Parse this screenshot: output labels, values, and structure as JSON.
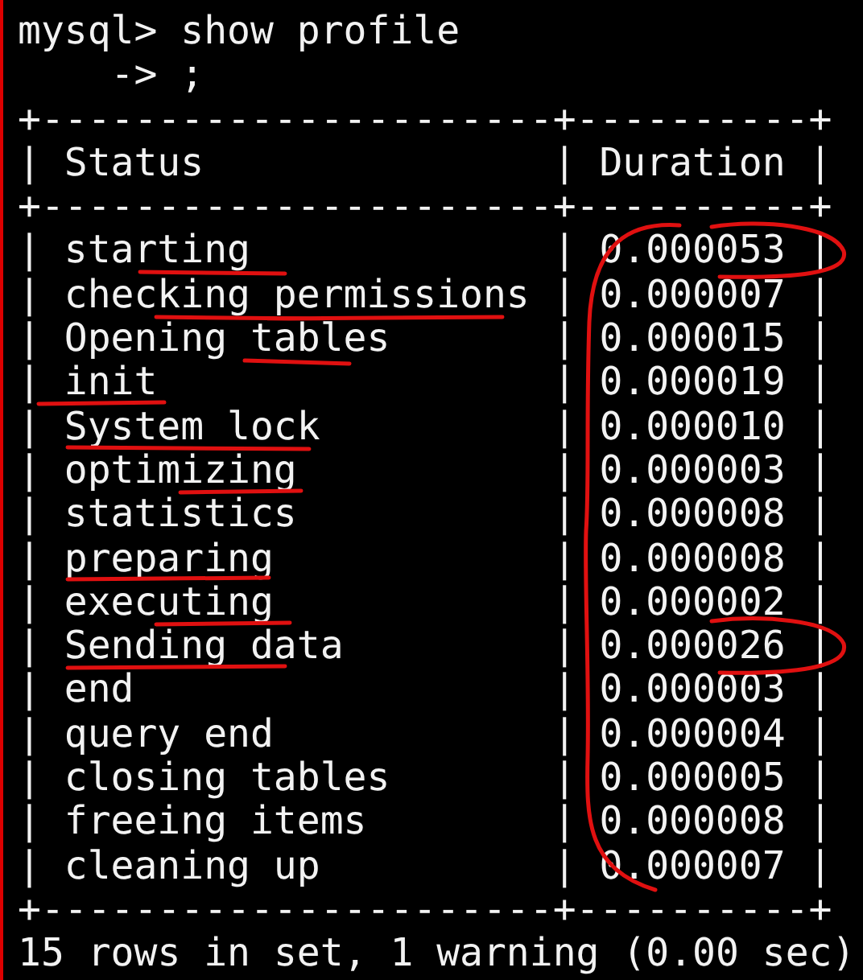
{
  "prompt": "mysql> show profile",
  "continuation": "    -> ;",
  "separator": "+----------------------+----------+",
  "column_rule": "|",
  "columns": [
    "Status",
    "Duration"
  ],
  "rows": [
    {
      "status": "starting",
      "duration": "0.000053"
    },
    {
      "status": "checking permissions",
      "duration": "0.000007"
    },
    {
      "status": "Opening tables",
      "duration": "0.000015"
    },
    {
      "status": "init",
      "duration": "0.000019"
    },
    {
      "status": "System lock",
      "duration": "0.000010"
    },
    {
      "status": "optimizing",
      "duration": "0.000003"
    },
    {
      "status": "statistics",
      "duration": "0.000008"
    },
    {
      "status": "preparing",
      "duration": "0.000008"
    },
    {
      "status": "executing",
      "duration": "0.000002"
    },
    {
      "status": "Sending data",
      "duration": "0.000026"
    },
    {
      "status": "end",
      "duration": "0.000003"
    },
    {
      "status": "query end",
      "duration": "0.000004"
    },
    {
      "status": "closing tables",
      "duration": "0.000005"
    },
    {
      "status": "freeing items",
      "duration": "0.000008"
    },
    {
      "status": "cleaning up",
      "duration": "0.000007"
    }
  ],
  "footer": "15 rows in set, 1 warning (0.00 sec)"
}
